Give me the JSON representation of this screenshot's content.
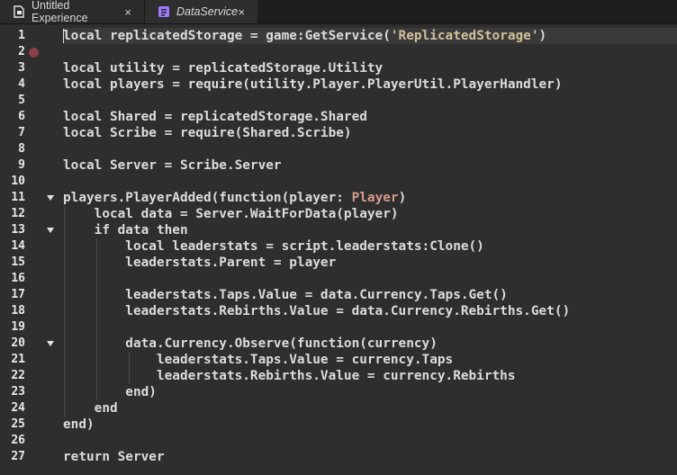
{
  "tabs": [
    {
      "label": "Untitled Experience",
      "icon": "document-icon",
      "close": "×"
    },
    {
      "label": "DataService",
      "icon": "script-icon",
      "close": "×"
    }
  ],
  "colors": {
    "background": "#2e2e2e",
    "text": "#dcdcdc",
    "string": "#d2c09a",
    "type": "#d59b8a",
    "breakpoint": "#8a3f45",
    "script_icon": "#9e7bff"
  },
  "editor": {
    "breakpoint_line": 2,
    "fold_lines": [
      11,
      13,
      20
    ],
    "line_numbers": [
      "1",
      "2",
      "3",
      "4",
      "5",
      "6",
      "7",
      "8",
      "9",
      "10",
      "11",
      "12",
      "13",
      "14",
      "15",
      "16",
      "17",
      "18",
      "19",
      "20",
      "21",
      "22",
      "23",
      "24",
      "25",
      "26",
      "27"
    ],
    "lines": [
      "local replicatedStorage = game:GetService('ReplicatedStorage')",
      "",
      "local utility = replicatedStorage.Utility",
      "local players = require(utility.Player.PlayerUtil.PlayerHandler)",
      "",
      "local Shared = replicatedStorage.Shared",
      "local Scribe = require(Shared.Scribe)",
      "",
      "local Server = Scribe.Server",
      "",
      "players.PlayerAdded(function(player: Player)",
      "    local data = Server.WaitForData(player)",
      "    if data then",
      "        local leaderstats = script.leaderstats:Clone()",
      "        leaderstats.Parent = player",
      "",
      "        leaderstats.Taps.Value = data.Currency.Taps.Get()",
      "        leaderstats.Rebirths.Value = data.Currency.Rebirths.Get()",
      "",
      "        data.Currency.Observe(function(currency)",
      "            leaderstats.Taps.Value = currency.Taps",
      "            leaderstats.Rebirths.Value = currency.Rebirths",
      "        end)",
      "    end",
      "end)",
      "",
      "return Server"
    ]
  }
}
